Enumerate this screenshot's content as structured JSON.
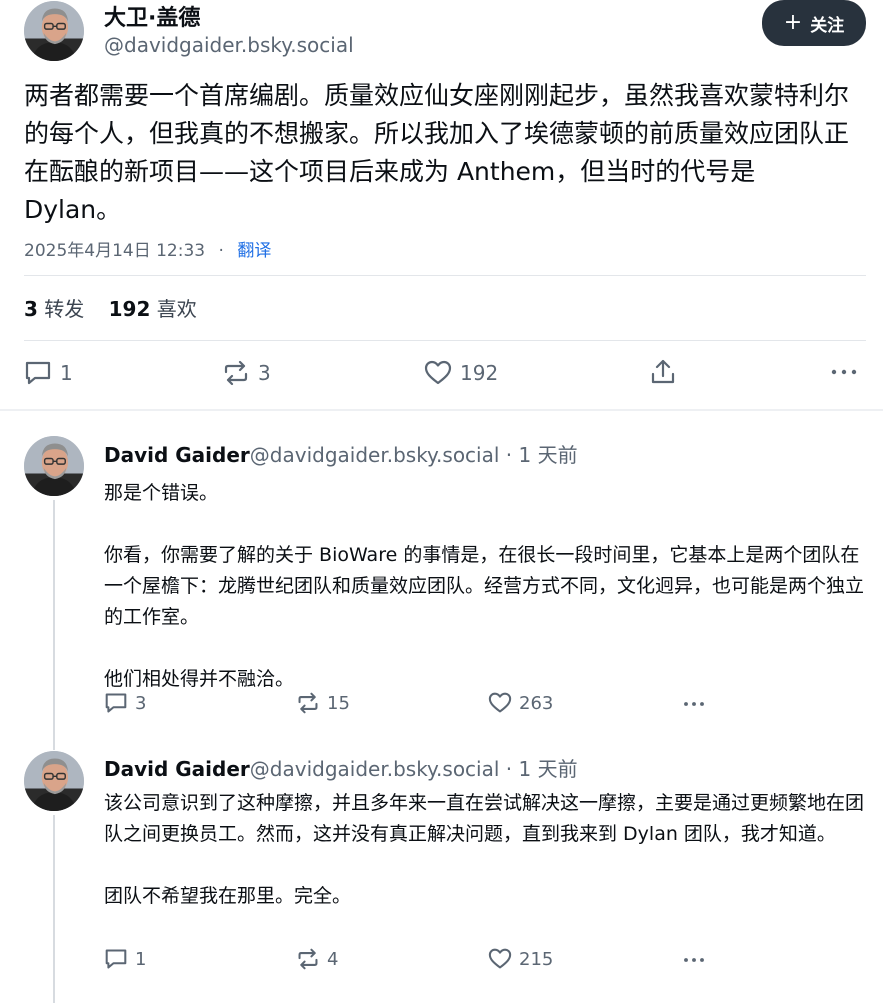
{
  "post": {
    "author_name": "大卫·盖德",
    "author_handle": "@davidgaider.bsky.social",
    "follow_label": "关注",
    "text": "两者都需要一个首席编剧。质量效应仙女座刚刚起步，虽然我喜欢蒙特利尔的每个人，但我真的不想搬家。所以我加入了埃德蒙顿的前质量效应团队正在酝酿的新项目——这个项目后来成为 Anthem，但当时的代号是 Dylan。",
    "timestamp": "2025年4月14日 12:33",
    "separator": "·",
    "translate_label": "翻译",
    "reposts_count": "3",
    "reposts_label": "转发",
    "likes_count": "192",
    "likes_label": "喜欢",
    "actions": {
      "replies": "1",
      "reposts": "3",
      "likes": "192"
    }
  },
  "replies": [
    {
      "name": "David Gaider",
      "handle": "@davidgaider.bsky.social",
      "time": " · 1 天前",
      "paragraphs": [
        "那是个错误。",
        "你看，你需要了解的关于 BioWare 的事情是，在很长一段时间里，它基本上是两个团队在一个屋檐下：龙腾世纪团队和质量效应团队。经营方式不同，文化迥异，也可能是两个独立的工作室。",
        "他们相处得并不融洽。"
      ],
      "actions": {
        "replies": "3",
        "reposts": "15",
        "likes": "263"
      }
    },
    {
      "name": "David Gaider",
      "handle": "@davidgaider.bsky.social",
      "time": " · 1 天前",
      "paragraphs": [
        "该公司意识到了这种摩擦，并且多年来一直在尝试解决这一摩擦，主要是通过更频繁地在团队之间更换员工。然而，这并没有真正解决问题，直到我来到 Dylan 团队，我才知道。",
        "团队不希望我在那里。完全。"
      ],
      "actions": {
        "replies": "1",
        "reposts": "4",
        "likes": "215"
      }
    }
  ],
  "icons": {
    "reply": "speech-bubble-icon",
    "repost": "repost-arrows-icon",
    "like": "heart-icon",
    "share": "share-upload-icon",
    "more": "more-dots-icon"
  },
  "colors": {
    "follow_button_bg": "#28323d",
    "translate_link": "#1f6fe5",
    "muted_text": "#5b6673"
  }
}
